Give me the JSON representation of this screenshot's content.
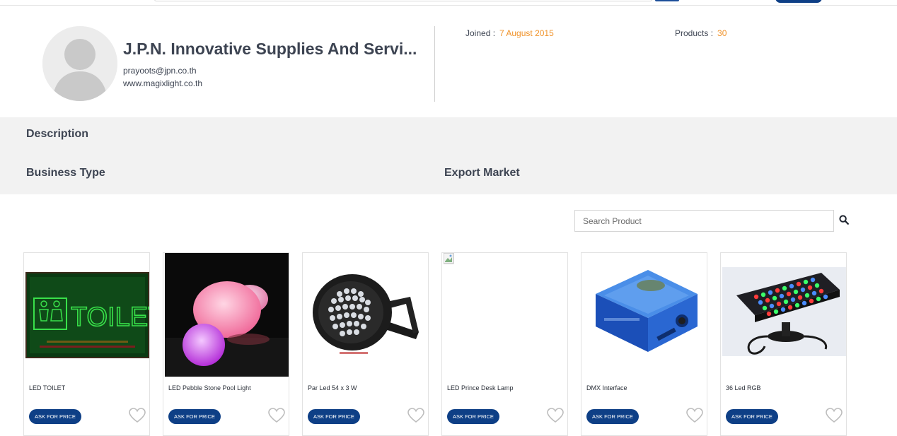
{
  "colors": {
    "accent": "#f0932b",
    "brand": "#0e3f86",
    "band": "#f2f2f2"
  },
  "profile": {
    "company_name": "J.P.N. Innovative Supplies And Servi...",
    "email": "prayoots@jpn.co.th",
    "website": "www.magixlight.co.th",
    "joined_label": "Joined :",
    "joined_value": "7 August 2015",
    "products_label": "Products :",
    "products_value": "30"
  },
  "info": {
    "description_label": "Description",
    "business_type_label": "Business Type",
    "export_market_label": "Export Market"
  },
  "search": {
    "placeholder": "Search Product",
    "icon": "search-icon"
  },
  "products": [
    {
      "title": "LED TOILET",
      "button": "ASK FOR PRICE"
    },
    {
      "title": "LED Pebble Stone Pool Light",
      "button": "ASK FOR PRICE"
    },
    {
      "title": "Par Led 54 x 3 W",
      "button": "ASK FOR PRICE"
    },
    {
      "title": "LED Prince Desk Lamp",
      "button": "ASK FOR PRICE"
    },
    {
      "title": "DMX Interface",
      "button": "ASK FOR PRICE"
    },
    {
      "title": "36 Led RGB",
      "button": "ASK FOR PRICE"
    }
  ],
  "product_image_texts": {
    "toilet_sign": "TOILET"
  }
}
